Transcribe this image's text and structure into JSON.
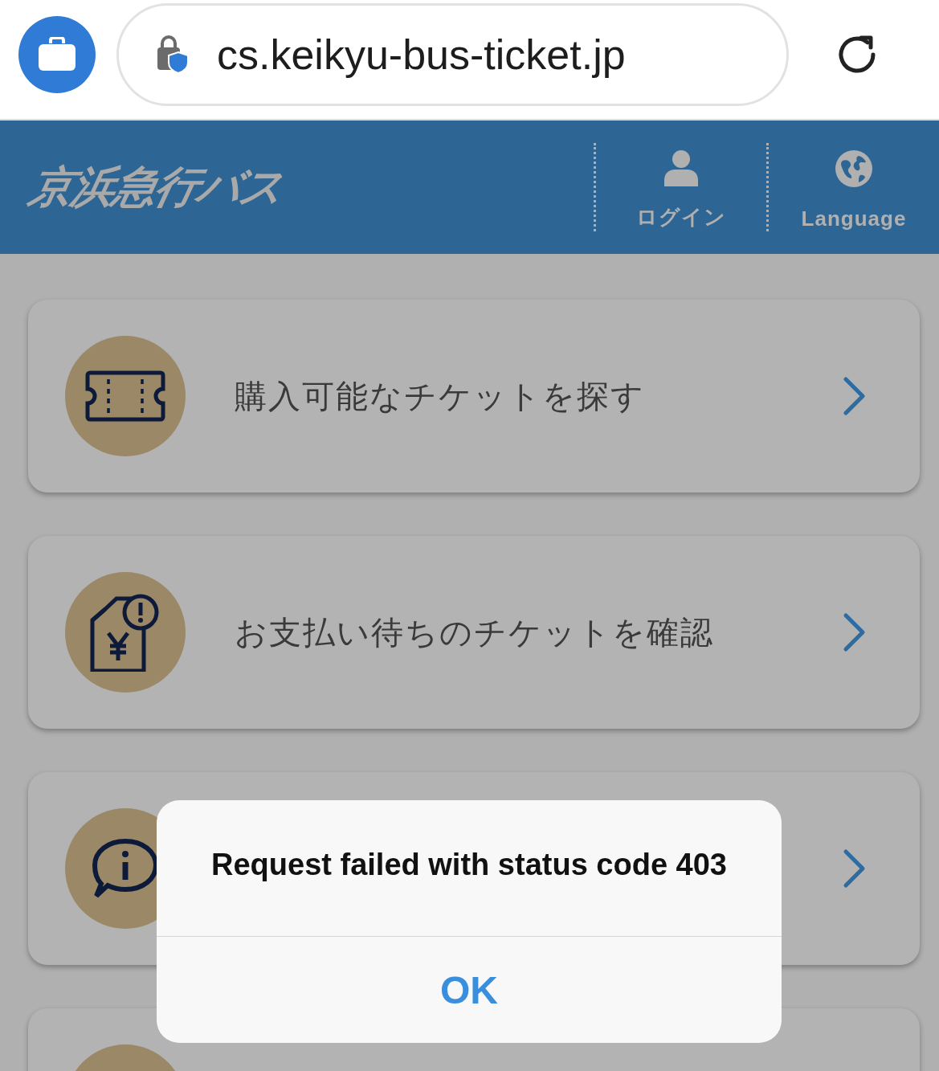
{
  "browser": {
    "url": "cs.keikyu-bus-ticket.jp"
  },
  "header": {
    "logo": "京浜急行バス",
    "nav": [
      {
        "kind": "user",
        "label": "ログイン"
      },
      {
        "kind": "globe",
        "label": "Language"
      }
    ]
  },
  "menu": [
    {
      "kind": "ticket",
      "label": "購入可能なチケットを探す"
    },
    {
      "kind": "payment",
      "label": "お支払い待ちのチケットを確認"
    },
    {
      "kind": "info"
    },
    {
      "kind": "blank"
    }
  ],
  "dialog": {
    "message": "Request failed with status code 403",
    "button": "OK"
  }
}
